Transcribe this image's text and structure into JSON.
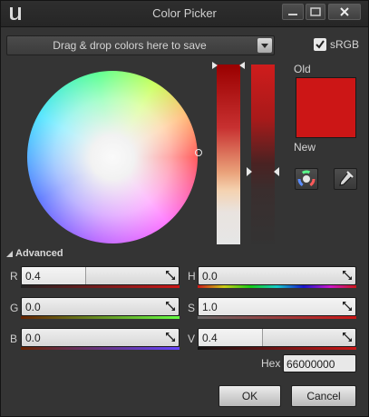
{
  "window": {
    "title": "Color Picker"
  },
  "palette": {
    "drop_label": "Drag & drop colors here to save"
  },
  "srgb": {
    "label": "sRGB",
    "checked": true
  },
  "preview": {
    "old_label": "Old",
    "new_label": "New",
    "old_color": "#cc1616",
    "new_color": "#cc1616"
  },
  "advanced": {
    "label": "Advanced"
  },
  "channels": {
    "r": {
      "label": "R",
      "value": "0.4"
    },
    "g": {
      "label": "G",
      "value": "0.0"
    },
    "b": {
      "label": "B",
      "value": "0.0"
    },
    "h": {
      "label": "H",
      "value": "0.0"
    },
    "s": {
      "label": "S",
      "value": "1.0"
    },
    "v": {
      "label": "V",
      "value": "0.4"
    }
  },
  "hex": {
    "label": "Hex",
    "value": "66000000"
  },
  "buttons": {
    "ok": "OK",
    "cancel": "Cancel"
  },
  "icons": {
    "logo": "unreal-logo-icon",
    "wheel_mode": "color-wheel-icon",
    "eyedropper": "eyedropper-icon"
  },
  "colors": {
    "accent_red": "#cc1616",
    "window_bg": "#343434",
    "field_bg": "#e3e3e3"
  }
}
